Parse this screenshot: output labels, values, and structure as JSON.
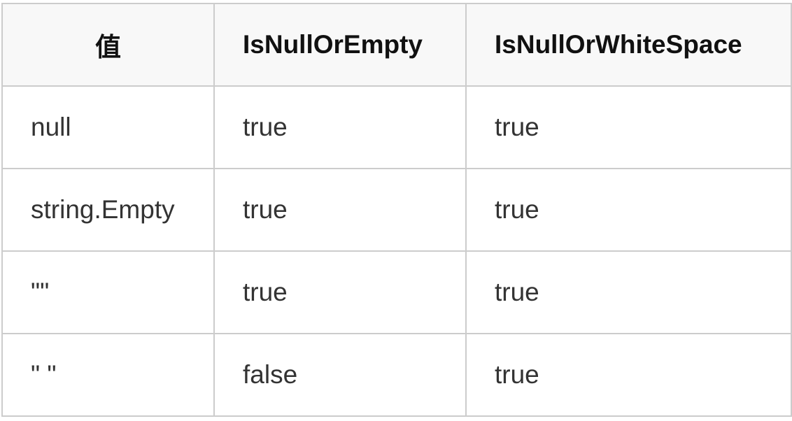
{
  "table": {
    "headers": [
      "值",
      "IsNullOrEmpty",
      "IsNullOrWhiteSpace"
    ],
    "rows": [
      [
        "null",
        "true",
        "true"
      ],
      [
        "string.Empty",
        "true",
        "true"
      ],
      [
        "\"\"",
        "true",
        "true"
      ],
      [
        "\" \"",
        "false",
        "true"
      ]
    ]
  }
}
